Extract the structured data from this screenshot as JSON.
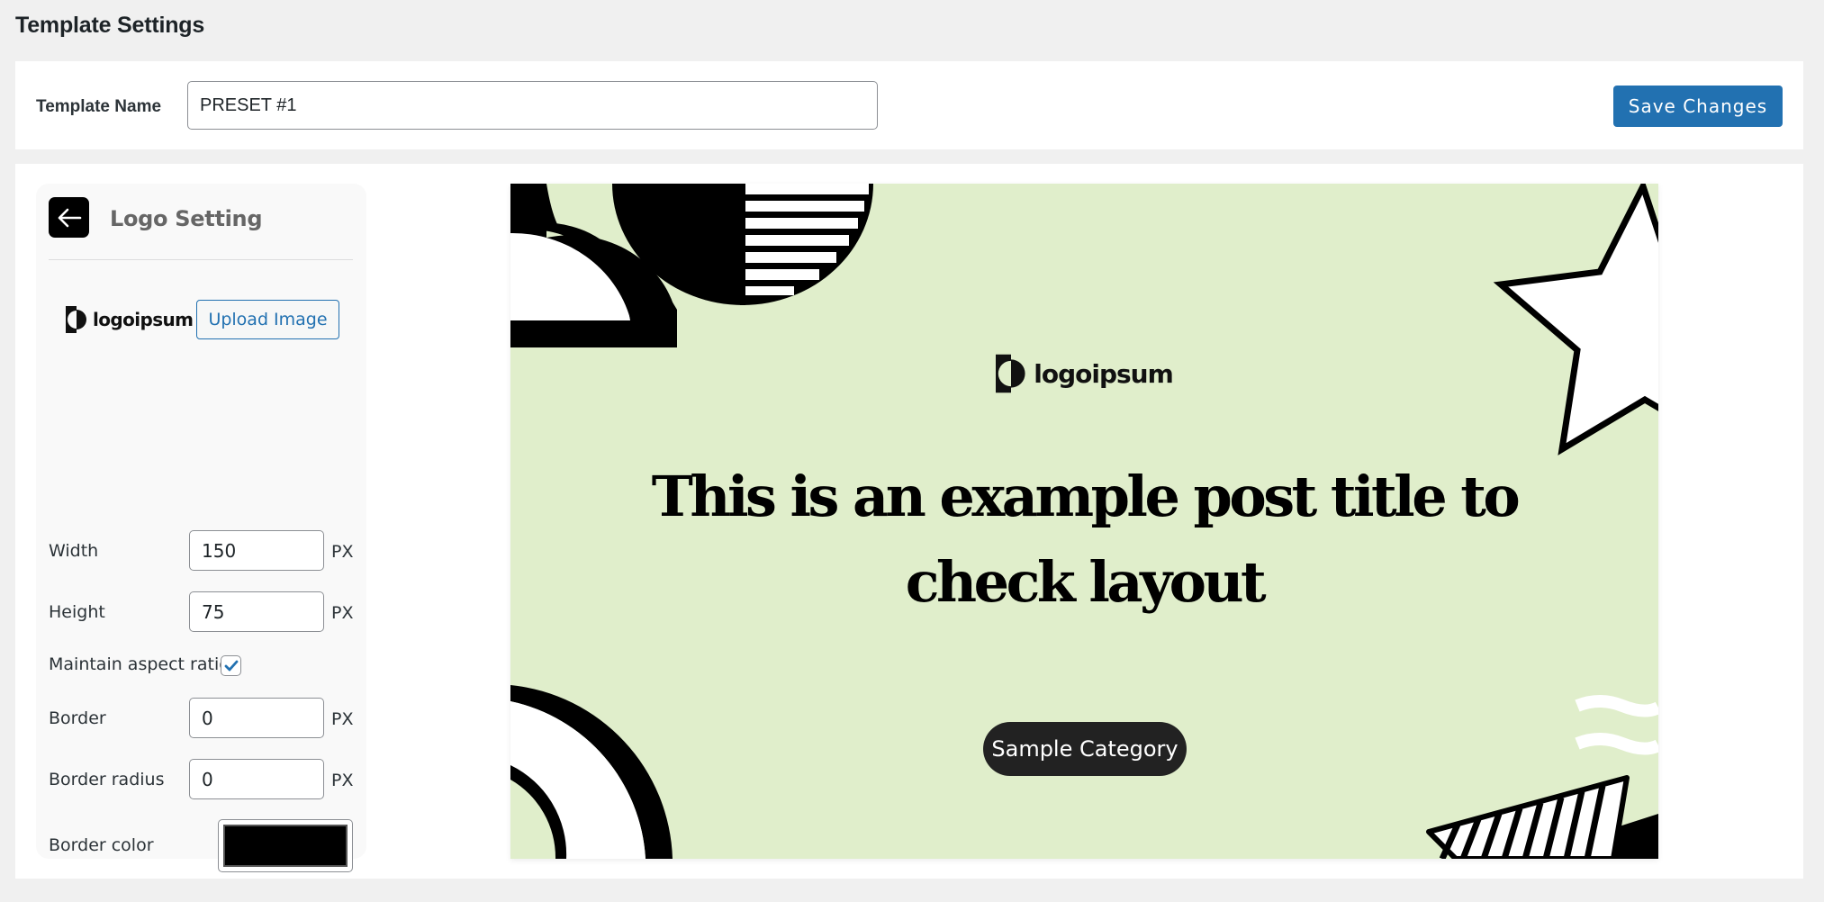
{
  "page": {
    "title": "Template Settings"
  },
  "template": {
    "name_label": "Template Name",
    "name_value": "PRESET #1",
    "save_label": "Save Changes"
  },
  "sidebar": {
    "back_icon": "arrow-left-icon",
    "title": "Logo Setting",
    "logo_text": "logoipsum",
    "upload_label": "Upload Image",
    "fields": {
      "width": {
        "label": "Width",
        "value": "150",
        "unit": "PX"
      },
      "height": {
        "label": "Height",
        "value": "75",
        "unit": "PX"
      },
      "aspect": {
        "label": "Maintain aspect ratio",
        "checked": true
      },
      "border": {
        "label": "Border",
        "value": "0",
        "unit": "PX"
      },
      "border_radius": {
        "label": "Border radius",
        "value": "0",
        "unit": "PX"
      },
      "border_color": {
        "label": "Border color",
        "value": "#000000"
      }
    }
  },
  "preview": {
    "background": "#e0eecb",
    "logo_text": "logoipsum",
    "post_title": "This is an example post title to check layout",
    "category": "Sample Category"
  },
  "colors": {
    "accent": "#2271b1",
    "category_bg": "#222222"
  }
}
